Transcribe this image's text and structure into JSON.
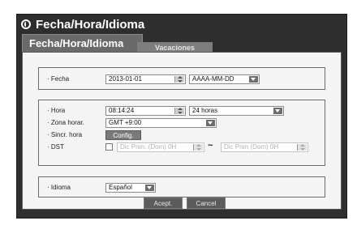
{
  "window": {
    "title": "Fecha/Hora/Idioma",
    "title_icon": "globe-icon"
  },
  "tabs": [
    {
      "label": "Fecha/Hora/Idioma",
      "active": true
    },
    {
      "label": "Vacaciones",
      "active": false
    }
  ],
  "date_group": {
    "fecha_label": "· Fecha",
    "fecha_value": "2013-01-01",
    "format_value": "AAAA-MM-DD"
  },
  "time_group": {
    "hora_label": "· Hora",
    "hora_value": "08:14:24",
    "hora_format": "24 horas",
    "zona_label": "· Zona horar.",
    "zona_value": "GMT +9:00",
    "sincr_label": "· Sincr. hora",
    "sincr_button": "Config.",
    "dst_label": "· DST",
    "dst_start": "Dic Prim. (Dom) 0H",
    "dst_separator": "~",
    "dst_end": "Dic Prim (Dom) 0H"
  },
  "language_group": {
    "idioma_label": "· Idioma",
    "idioma_value": "Español"
  },
  "footer": {
    "accept": "Acept.",
    "cancel": "Cancel"
  }
}
